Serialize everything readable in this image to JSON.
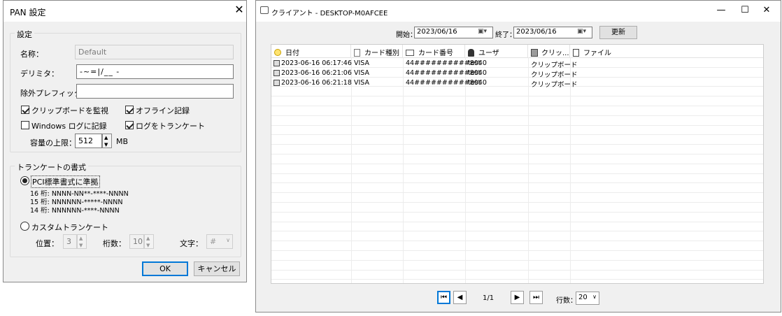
{
  "pan_dialog": {
    "title": "PAN 設定",
    "settings_group": {
      "label": "設定",
      "name_label": "名称：",
      "name_value": "Default",
      "delimiter_label": "デリミタ：",
      "delimiter_value": "-~=|/__ -",
      "exclude_prefix_label": "除外プレフィックス：",
      "exclude_prefix_value": "",
      "monitor_clipboard": {
        "label": "クリップボードを監視",
        "checked": true
      },
      "offline_log": {
        "label": "オフライン記録",
        "checked": true
      },
      "windows_log": {
        "label": "Windows ログに記録",
        "checked": false
      },
      "truncate_log": {
        "label": "ログをトランケート",
        "checked": true
      },
      "capacity_label": "容量の上限：",
      "capacity_value": "512",
      "capacity_unit": "MB"
    },
    "truncate_group": {
      "label": "トランケートの書式",
      "pci_option": {
        "label": "PCI標準書式に準拠",
        "selected": true
      },
      "formats": [
        "16 桁: NNNN-NN**-****-NNNN",
        "15 桁: NNNNNN-*****-NNNN",
        "14 桁: NNNNNN-****-NNNN"
      ],
      "custom_option": {
        "label": "カスタムトランケート",
        "selected": false
      },
      "position_label": "位置：",
      "position_value": "3",
      "digits_label": "桁数：",
      "digits_value": "10",
      "char_label": "文字：",
      "char_value": "#"
    },
    "ok_label": "OK",
    "cancel_label": "キャンセル",
    "close_glyph": "✕"
  },
  "client_window": {
    "title": "クライアント - DESKTOP-M0AFCEE",
    "minimize_glyph": "—",
    "maximize_glyph": "☐",
    "close_glyph": "✕",
    "start_label": "開始：",
    "start_date": "2023/06/16",
    "end_label": "終了：",
    "end_date": "2023/06/16",
    "refresh_label": "更新",
    "columns": [
      "日付",
      "カード種別",
      "カード番号",
      "ユーザ",
      "クリッ...",
      "ファイル"
    ],
    "rows": [
      {
        "date": "2023-06-16 06:17:46",
        "type": "VISA",
        "number": "44##########8040",
        "user": "test",
        "source": "クリップボード",
        "file": ""
      },
      {
        "date": "2023-06-16 06:21:06",
        "type": "VISA",
        "number": "44##########8040",
        "user": "test",
        "source": "クリップボード",
        "file": ""
      },
      {
        "date": "2023-06-16 06:21:18",
        "type": "VISA",
        "number": "44##########8040",
        "user": "test",
        "source": "クリップボード",
        "file": ""
      }
    ],
    "pager": {
      "first_glyph": "⏮",
      "prev_glyph": "◀",
      "page_text": "1/1",
      "next_glyph": "▶",
      "last_glyph": "⏭",
      "rows_label": "行数：",
      "rows_value": "20"
    },
    "icons": [
      "clock-icon",
      "document-icon",
      "card-icon",
      "user-icon",
      "clipboard-icon",
      "file-icon",
      "log-row-icon",
      "calendar-icon",
      "app-icon"
    ]
  }
}
